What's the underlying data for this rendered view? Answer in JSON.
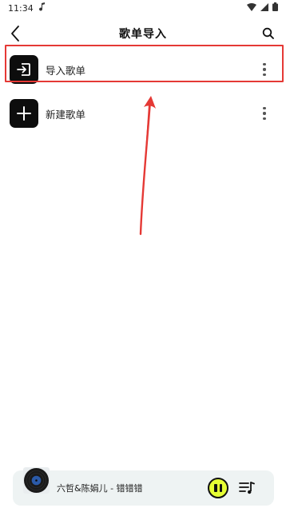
{
  "status_bar": {
    "time": "11:34"
  },
  "header": {
    "title": "歌单导入"
  },
  "list": [
    {
      "label": "导入歌单",
      "icon": "import-icon"
    },
    {
      "label": "新建歌单",
      "icon": "plus-icon"
    }
  ],
  "player": {
    "song": "六哲&陈娟儿 - 错错错",
    "state": "playing"
  },
  "colors": {
    "highlight": "#e53935",
    "accent": "#e6ff34",
    "player_bg": "#eef3f3"
  }
}
